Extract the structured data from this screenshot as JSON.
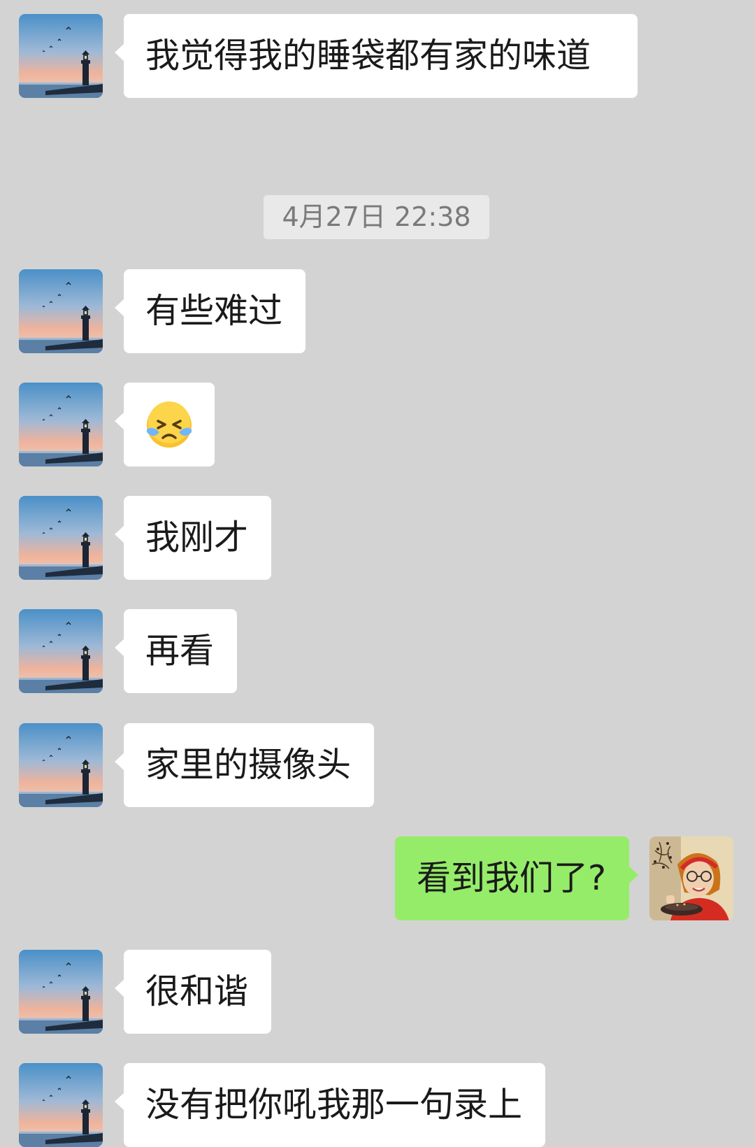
{
  "messages": [
    {
      "side": "left",
      "type": "text",
      "text": "我觉得我的睡袋都有家的味道"
    },
    {
      "side": "center",
      "type": "timestamp",
      "text": "4月27日 22:38"
    },
    {
      "side": "left",
      "type": "text",
      "text": "有些难过"
    },
    {
      "side": "left",
      "type": "emoji",
      "emoji": "crying-face-emoji"
    },
    {
      "side": "left",
      "type": "text",
      "text": "我刚才"
    },
    {
      "side": "left",
      "type": "text",
      "text": "再看"
    },
    {
      "side": "left",
      "type": "text",
      "text": "家里的摄像头"
    },
    {
      "side": "right",
      "type": "text",
      "text": "看到我们了?"
    },
    {
      "side": "left",
      "type": "text",
      "text": "很和谐"
    },
    {
      "side": "left",
      "type": "text",
      "text": "没有把你吼我那一句录上"
    }
  ],
  "avatars": {
    "contact": "lighthouse-sunset-avatar",
    "self": "woman-with-glasses-avatar"
  },
  "colors": {
    "background": "#d3d3d3",
    "incoming_bubble": "#ffffff",
    "outgoing_bubble": "#95ec69",
    "timestamp_bg": "#e9e9e9",
    "timestamp_text": "#7a7a7a"
  }
}
